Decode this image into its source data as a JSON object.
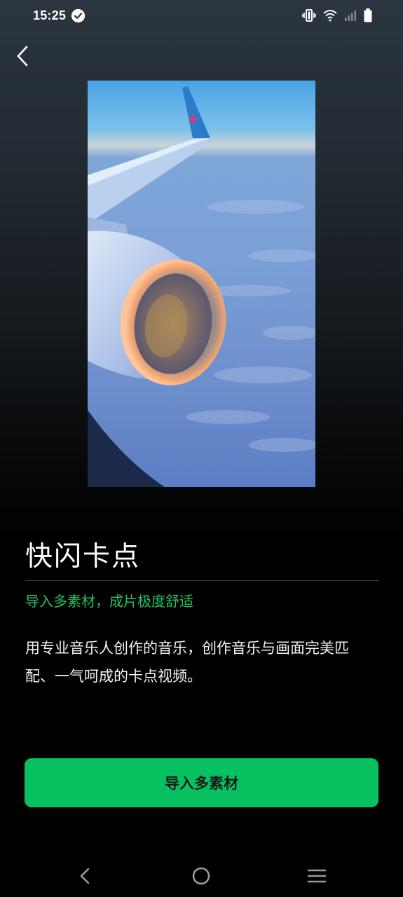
{
  "status_bar": {
    "time": "15:25",
    "icons": [
      "check-circle-icon",
      "vibrate-icon",
      "wifi-icon",
      "signal-icon",
      "battery-icon"
    ]
  },
  "header": {
    "back_icon": "chevron-left-icon"
  },
  "preview": {
    "icon": "airplane-wing-video-thumbnail"
  },
  "content": {
    "title": "快闪卡点",
    "subtitle": "导入多素材，成片极度舒适",
    "description": "用专业音乐人创作的音乐，创作音乐与画面完美匹配、一气呵成的卡点视频。"
  },
  "actions": {
    "import_label": "导入多素材"
  },
  "colors": {
    "accent": "#07c160",
    "subtitle": "#27c260",
    "background_top": "#2c3640",
    "background_bottom": "#000000"
  },
  "nav_bar": {
    "icons": [
      "back-triangle-icon",
      "home-circle-icon",
      "menu-lines-icon"
    ]
  }
}
